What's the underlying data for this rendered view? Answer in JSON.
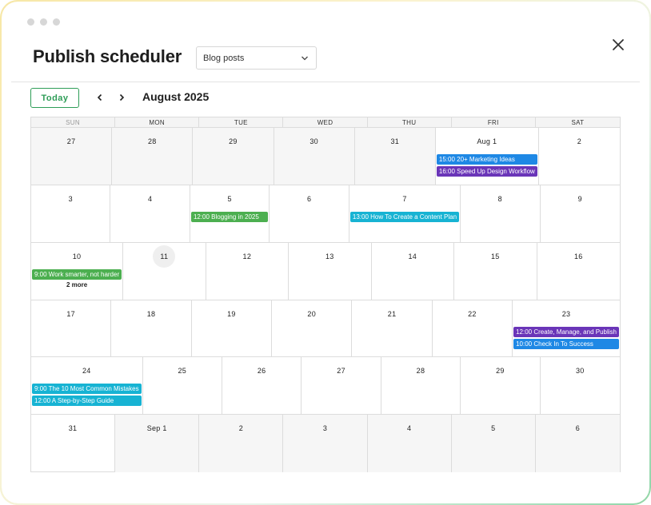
{
  "window": {
    "title": "Publish scheduler"
  },
  "filter": {
    "selected": "Blog posts"
  },
  "toolbar": {
    "today_label": "Today",
    "month_label": "August 2025"
  },
  "colors": {
    "accent": "#2e9d57",
    "event_blue": "#1e88e5",
    "event_purple": "#6a35b8",
    "event_green": "#4caf50",
    "event_teal": "#17b3d3"
  },
  "calendar": {
    "weekdays": [
      "SUN",
      "MON",
      "TUE",
      "WED",
      "THU",
      "FRI",
      "SAT"
    ],
    "weeks": [
      [
        {
          "label": "27",
          "muted": true,
          "events": []
        },
        {
          "label": "28",
          "muted": true,
          "events": []
        },
        {
          "label": "29",
          "muted": true,
          "events": []
        },
        {
          "label": "30",
          "muted": true,
          "events": []
        },
        {
          "label": "31",
          "muted": true,
          "events": []
        },
        {
          "label": "Aug 1",
          "muted": false,
          "events": [
            {
              "text": "15:00 20+ Marketing Ideas",
              "color": "#1e88e5"
            },
            {
              "text": "16:00 Speed Up Design Workflow",
              "color": "#6a35b8"
            }
          ]
        },
        {
          "label": "2",
          "muted": false,
          "events": []
        }
      ],
      [
        {
          "label": "3",
          "muted": false,
          "events": []
        },
        {
          "label": "4",
          "muted": false,
          "events": []
        },
        {
          "label": "5",
          "muted": false,
          "events": [
            {
              "text": "12:00 Blogging in 2025",
              "color": "#4caf50"
            }
          ]
        },
        {
          "label": "6",
          "muted": false,
          "events": []
        },
        {
          "label": "7",
          "muted": false,
          "events": [
            {
              "text": "13:00 How To Create a Content Plan",
              "color": "#17b3d3"
            }
          ]
        },
        {
          "label": "8",
          "muted": false,
          "events": []
        },
        {
          "label": "9",
          "muted": false,
          "events": []
        }
      ],
      [
        {
          "label": "10",
          "muted": false,
          "events": [
            {
              "text": "9:00 Work smarter, not harder",
              "color": "#4caf50"
            }
          ],
          "more": "2 more"
        },
        {
          "label": "11",
          "muted": false,
          "today": true,
          "events": []
        },
        {
          "label": "12",
          "muted": false,
          "events": []
        },
        {
          "label": "13",
          "muted": false,
          "events": []
        },
        {
          "label": "14",
          "muted": false,
          "events": []
        },
        {
          "label": "15",
          "muted": false,
          "events": []
        },
        {
          "label": "16",
          "muted": false,
          "events": []
        }
      ],
      [
        {
          "label": "17",
          "muted": false,
          "events": []
        },
        {
          "label": "18",
          "muted": false,
          "events": []
        },
        {
          "label": "19",
          "muted": false,
          "events": []
        },
        {
          "label": "20",
          "muted": false,
          "events": []
        },
        {
          "label": "21",
          "muted": false,
          "events": []
        },
        {
          "label": "22",
          "muted": false,
          "events": []
        },
        {
          "label": "23",
          "muted": false,
          "events": [
            {
              "text": "12:00 Create, Manage, and Publish",
              "color": "#6a35b8"
            },
            {
              "text": "10:00 Check In To Success",
              "color": "#1e88e5"
            }
          ]
        }
      ],
      [
        {
          "label": "24",
          "muted": false,
          "events": [
            {
              "text": "9:00 The 10 Most Common Mistakes",
              "color": "#17b3d3"
            },
            {
              "text": "12:00 A Step-by-Step Guide",
              "color": "#17b3d3"
            }
          ]
        },
        {
          "label": "25",
          "muted": false,
          "events": []
        },
        {
          "label": "26",
          "muted": false,
          "events": []
        },
        {
          "label": "27",
          "muted": false,
          "events": []
        },
        {
          "label": "28",
          "muted": false,
          "events": []
        },
        {
          "label": "29",
          "muted": false,
          "events": []
        },
        {
          "label": "30",
          "muted": false,
          "events": []
        }
      ],
      [
        {
          "label": "31",
          "muted": false,
          "events": []
        },
        {
          "label": "Sep 1",
          "muted": true,
          "events": []
        },
        {
          "label": "2",
          "muted": true,
          "events": []
        },
        {
          "label": "3",
          "muted": true,
          "events": []
        },
        {
          "label": "4",
          "muted": true,
          "events": []
        },
        {
          "label": "5",
          "muted": true,
          "events": []
        },
        {
          "label": "6",
          "muted": true,
          "events": []
        }
      ]
    ]
  }
}
